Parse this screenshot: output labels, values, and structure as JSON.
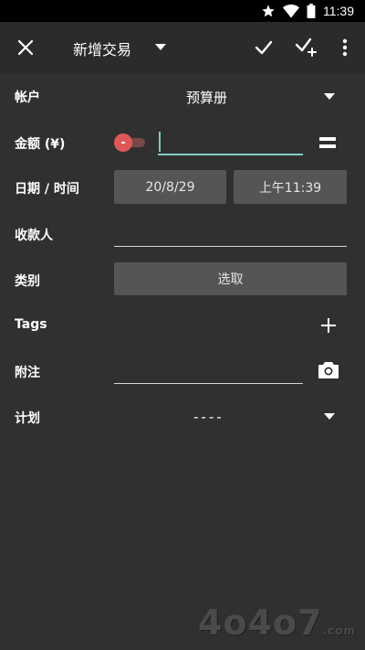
{
  "status_bar": {
    "time": "11:39"
  },
  "app_bar": {
    "title": "新增交易"
  },
  "form": {
    "account": {
      "label": "帐户",
      "value": "预算册"
    },
    "amount": {
      "label": "金额 (¥)",
      "toggle_symbol": "-",
      "value": ""
    },
    "datetime": {
      "label": "日期 / 时间",
      "date": "20/8/29",
      "time": "上午11:39"
    },
    "payee": {
      "label": "收款人",
      "value": ""
    },
    "category": {
      "label": "类别",
      "button": "选取"
    },
    "tags": {
      "label": "Tags"
    },
    "notes": {
      "label": "附注",
      "value": ""
    },
    "plan": {
      "label": "计划",
      "value": "----"
    }
  },
  "watermark": {
    "text": "4o4o7",
    "suffix": ".com"
  },
  "colors": {
    "background": "#303030",
    "accent": "#80cbc4",
    "toggle_red": "#e05757"
  }
}
